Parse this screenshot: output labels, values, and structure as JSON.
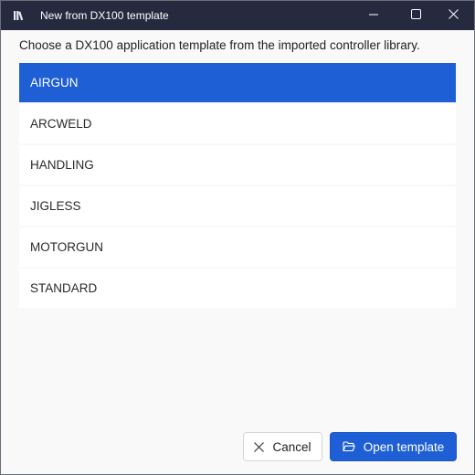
{
  "window": {
    "title": "New from DX100 template",
    "icon": "library-books-icon"
  },
  "caption_buttons": {
    "minimize_icon": "minimize-icon",
    "maximize_icon": "maximize-icon",
    "close_icon": "close-icon"
  },
  "instruction": "Choose a DX100 application template from the imported controller library.",
  "templates": {
    "selected": "AIRGUN",
    "items": [
      {
        "label": "AIRGUN",
        "selected": true
      },
      {
        "label": "ARCWELD",
        "selected": false
      },
      {
        "label": "HANDLING",
        "selected": false
      },
      {
        "label": "JIGLESS",
        "selected": false
      },
      {
        "label": "MOTORGUN",
        "selected": false
      },
      {
        "label": "STANDARD",
        "selected": false
      }
    ]
  },
  "buttons": {
    "cancel_label": "Cancel",
    "cancel_icon": "close-icon",
    "open_label": "Open template",
    "open_icon": "folder-open-icon"
  },
  "colors": {
    "titlebar": "#262a3f",
    "accent": "#1f5fd6",
    "background": "#f9f9fa"
  }
}
